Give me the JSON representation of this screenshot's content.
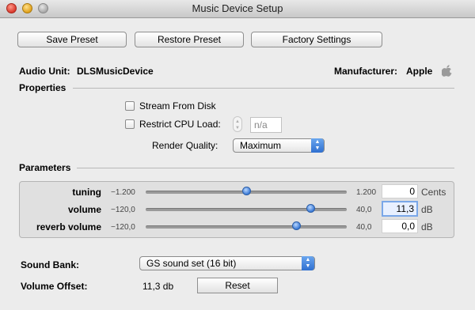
{
  "window": {
    "title": "Music Device Setup"
  },
  "toolbar": {
    "save_preset": "Save Preset",
    "restore_preset": "Restore Preset",
    "factory_settings": "Factory Settings"
  },
  "audio_unit": {
    "label": "Audio Unit:",
    "name": "DLSMusicDevice",
    "manufacturer_label": "Manufacturer:",
    "manufacturer": "Apple",
    "manufacturer_icon": "apple-logo-icon"
  },
  "properties": {
    "heading": "Properties",
    "stream_from_disk": {
      "label": "Stream From Disk",
      "checked": false
    },
    "restrict_cpu": {
      "label": "Restrict CPU Load:",
      "checked": false,
      "value": "n/a"
    },
    "render_quality": {
      "label": "Render Quality:",
      "value": "Maximum"
    }
  },
  "parameters": {
    "heading": "Parameters",
    "rows": [
      {
        "name": "tuning",
        "min": "−1.200",
        "max": "1.200",
        "value": "0",
        "unit": "Cents",
        "level": 0.5
      },
      {
        "name": "volume",
        "min": "−120,0",
        "max": "40,0",
        "value": "11,3",
        "unit": "dB",
        "level": 0.82
      },
      {
        "name": "reverb volume",
        "min": "−120,0",
        "max": "40,0",
        "value": "0,0",
        "unit": "dB",
        "level": 0.75
      }
    ]
  },
  "sound_bank": {
    "label": "Sound Bank:",
    "value": "GS sound set (16 bit)"
  },
  "volume_offset": {
    "label": "Volume Offset:",
    "value": "11,3 db",
    "reset": "Reset"
  },
  "colors": {
    "accent": "#3b7ad6",
    "focus_ring": "#7aa7e8"
  }
}
